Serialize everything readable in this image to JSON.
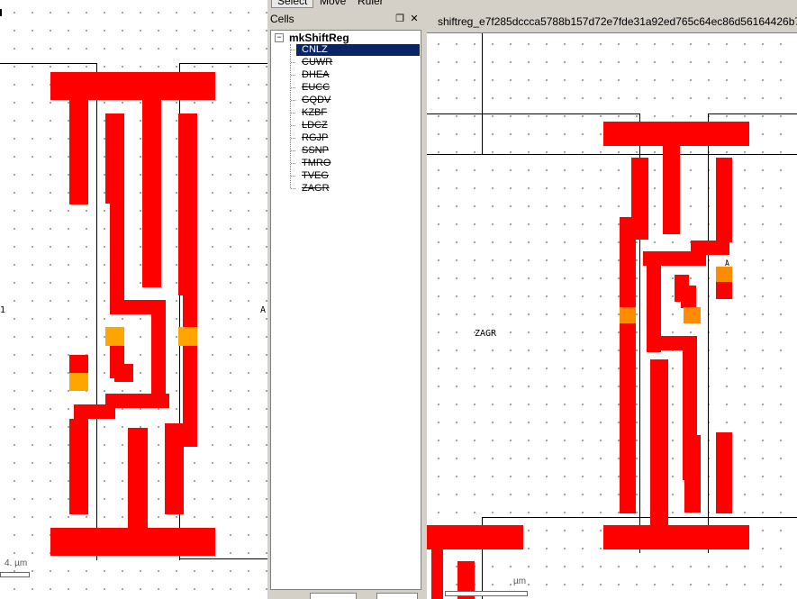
{
  "toolbar": {
    "tabs": [
      "Select",
      "Move",
      "Ruler"
    ]
  },
  "cells_panel": {
    "title": "Cells",
    "restore_icon": "restore-icon",
    "close_icon": "close-icon",
    "expander_symbol": "−",
    "root": "mkShiftReg",
    "items": [
      "CNLZ",
      "CUWR",
      "DHEA",
      "EUCC",
      "GQDV",
      "KZBF",
      "LDCZ",
      "RGJP",
      "SSNP",
      "TMRO",
      "TVEG",
      "ZAGR"
    ],
    "selected_index": 0
  },
  "left_view": {
    "pin_label_left": "1",
    "pin_label_right": "A",
    "scale_label": "4. µm"
  },
  "right_view": {
    "tab_title": "shiftreg_e7f285dccca5788b157d72e7fde31a92ed765c64ec86d56164426b7",
    "cell_label": "ZAGR",
    "pin_label": "A",
    "scale_label": "µm"
  },
  "colors": {
    "metal": "#ff0000",
    "contact": "#ffa500",
    "selection": "#0a246a"
  }
}
